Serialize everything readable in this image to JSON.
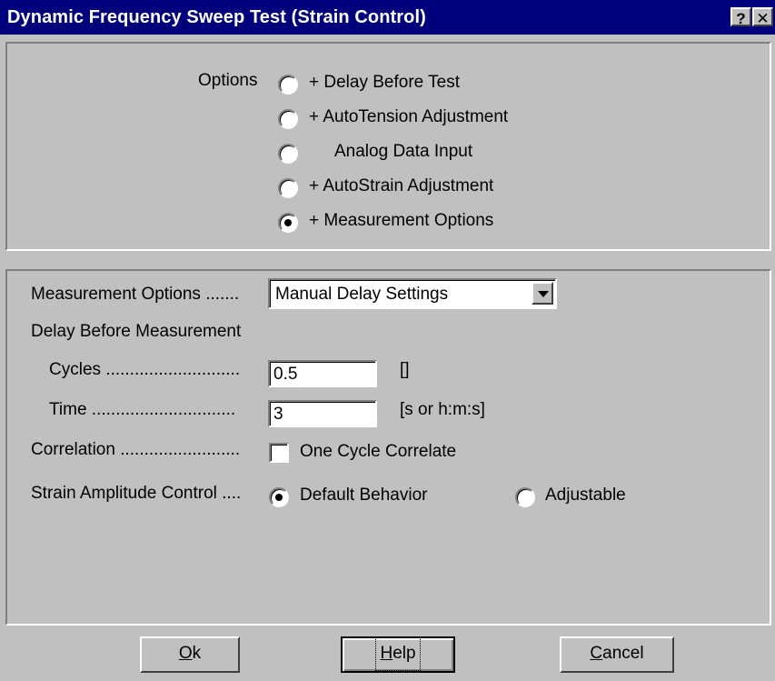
{
  "window": {
    "title": "Dynamic Frequency Sweep Test (Strain Control)",
    "help_button": "?",
    "close_button": "✕"
  },
  "options": {
    "label": "Options",
    "items": [
      {
        "label": "+  Delay Before Test",
        "checked": false
      },
      {
        "label": "+  AutoTension Adjustment",
        "checked": false
      },
      {
        "label": "Analog Data Input",
        "checked": false
      },
      {
        "label": "+  AutoStrain Adjustment",
        "checked": false
      },
      {
        "label": "+  Measurement Options",
        "checked": true
      }
    ]
  },
  "measurement": {
    "options_label": "Measurement Options .......",
    "options_value": "Manual Delay Settings",
    "delay_label": "Delay Before Measurement",
    "cycles_label": "Cycles ............................",
    "cycles_value": "0.5",
    "cycles_unit": "[]",
    "time_label": "Time ..............................",
    "time_value": "3",
    "time_unit": "[s or h:m:s]",
    "correlation_label": "Correlation .........................",
    "correlation_checkbox_label": "One Cycle Correlate",
    "correlation_checked": false,
    "strain_label": "Strain Amplitude Control ....",
    "strain_default_label": "Default Behavior",
    "strain_adjustable_label": "Adjustable",
    "strain_selected": "Default Behavior"
  },
  "buttons": {
    "ok_underline": "O",
    "ok_rest": "k",
    "help_underline": "H",
    "help_rest": "elp",
    "cancel_underline": "C",
    "cancel_rest": "ancel"
  }
}
